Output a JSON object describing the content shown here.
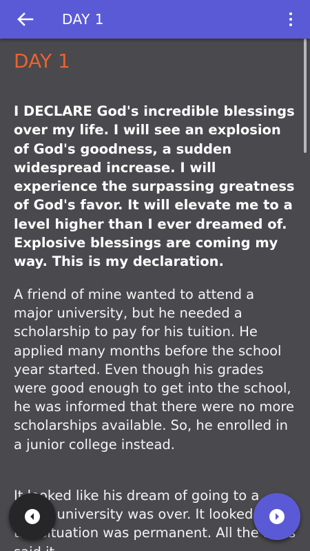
{
  "appbar": {
    "title": "DAY 1",
    "back_icon": "arrow-left-icon",
    "menu_icon": "more-vert-icon",
    "color": "#5b5ad6"
  },
  "content": {
    "heading": "DAY 1",
    "heading_color": "#e9642e",
    "declaration": "I DECLARE God's incredible blessings over my life. I will see an explosion of God's goodness, a sudden widespread increase. I will experience the surpassing greatness of God's favor. It will elevate me to a level higher than I ever dreamed of. Explosive blessings are coming my way. This is my declaration.",
    "paragraphs": [
      "A friend of mine wanted to attend a major university, but he needed a scholarship to pay for his tuition. He applied many months before the school year started. Even though his grades were good enough to get into the school, he was informed that there were no more scholarships available. So, he enrolled in a junior college instead.",
      "It looked like his dream of going to a major university was over. It looked like the situation was permanent. All the facts said it"
    ]
  },
  "nav": {
    "prev_icon": "chevron-left-circle-icon",
    "next_icon": "chevron-right-circle-icon"
  }
}
